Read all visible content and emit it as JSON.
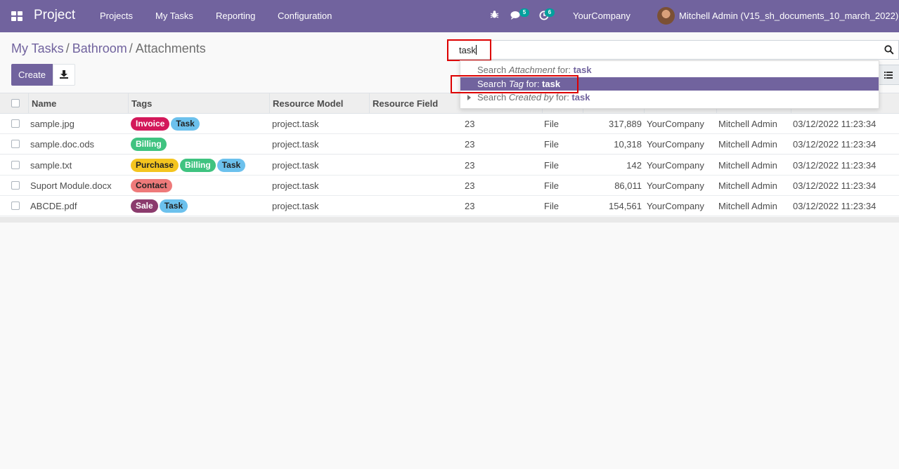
{
  "navbar": {
    "app_name": "Project",
    "menu": [
      "Projects",
      "My Tasks",
      "Reporting",
      "Configuration"
    ],
    "messages_count": "5",
    "activities_count": "6",
    "company": "YourCompany",
    "user": "Mitchell Admin (V15_sh_documents_10_march_2022)"
  },
  "breadcrumb": [
    "My Tasks",
    "Bathroom",
    "Attachments"
  ],
  "toolbar": {
    "create_label": "Create"
  },
  "search": {
    "value": "task"
  },
  "dropdown": [
    {
      "prefix": "Search ",
      "field": "Attachment",
      "mid": " for: ",
      "term": "task"
    },
    {
      "prefix": "Search ",
      "field": "Tag",
      "mid": " for: ",
      "term": "task"
    },
    {
      "prefix": "Search ",
      "field": "Created by",
      "mid": " for: ",
      "term": "task"
    }
  ],
  "table": {
    "columns": [
      "Name",
      "Tags",
      "Resource Model",
      "Resource Field"
    ],
    "rows": [
      {
        "name": "sample.jpg",
        "tags": [
          {
            "label": "Invoice",
            "color": "#d3185a",
            "text": "#ffffff"
          },
          {
            "label": "Task",
            "color": "#6cc1ed",
            "text": "#222222"
          }
        ],
        "model": "project.task",
        "res_id": "23",
        "type": "File",
        "size": "317,889",
        "company": "YourCompany",
        "owner": "Mitchell Admin",
        "date": "03/12/2022 11:23:34"
      },
      {
        "name": "sample.doc.ods",
        "tags": [
          {
            "label": "Billing",
            "color": "#3fc380",
            "text": "#ffffff"
          }
        ],
        "model": "project.task",
        "res_id": "23",
        "type": "File",
        "size": "10,318",
        "company": "YourCompany",
        "owner": "Mitchell Admin",
        "date": "03/12/2022 11:23:34"
      },
      {
        "name": "sample.txt",
        "tags": [
          {
            "label": "Purchase",
            "color": "#f4c51f",
            "text": "#222222"
          },
          {
            "label": "Billing",
            "color": "#3fc380",
            "text": "#ffffff"
          },
          {
            "label": "Task",
            "color": "#6cc1ed",
            "text": "#222222"
          }
        ],
        "model": "project.task",
        "res_id": "23",
        "type": "File",
        "size": "142",
        "company": "YourCompany",
        "owner": "Mitchell Admin",
        "date": "03/12/2022 11:23:34"
      },
      {
        "name": "Suport Module.docx",
        "tags": [
          {
            "label": "Contact",
            "color": "#ee7a7a",
            "text": "#222222"
          }
        ],
        "model": "project.task",
        "res_id": "23",
        "type": "File",
        "size": "86,011",
        "company": "YourCompany",
        "owner": "Mitchell Admin",
        "date": "03/12/2022 11:23:34"
      },
      {
        "name": "ABCDE.pdf",
        "tags": [
          {
            "label": "Sale",
            "color": "#8b3b6d",
            "text": "#ffffff"
          },
          {
            "label": "Task",
            "color": "#6cc1ed",
            "text": "#222222"
          }
        ],
        "model": "project.task",
        "res_id": "23",
        "type": "File",
        "size": "154,561",
        "company": "YourCompany",
        "owner": "Mitchell Admin",
        "date": "03/12/2022 11:23:34"
      }
    ]
  },
  "colors": {
    "primary": "#71639e",
    "highlight": "#dd0000"
  }
}
